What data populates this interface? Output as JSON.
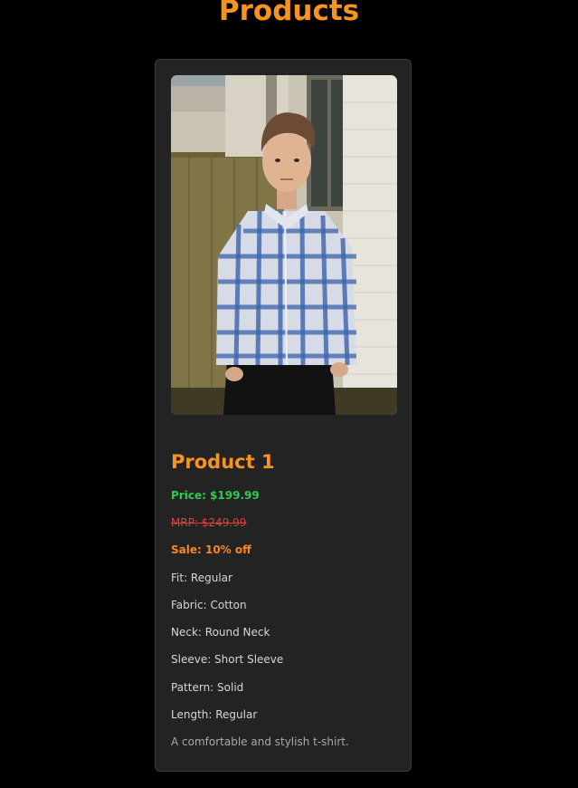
{
  "page": {
    "title": "Products"
  },
  "product": {
    "name": "Product 1",
    "price": "Price: $199.99",
    "mrp": "MRP: $249.99",
    "sale": "Sale: 10% off",
    "fit": "Fit: Regular",
    "fabric": "Fabric: Cotton",
    "neck": "Neck: Round Neck",
    "sleeve": "Sleeve: Short Sleeve",
    "pattern": "Pattern: Solid",
    "length": "Length: Regular",
    "description": "A comfortable and stylish t-shirt."
  },
  "colors": {
    "accent": "#f7931e",
    "price": "#2ecc4f",
    "mrp": "#d9433a",
    "sale": "#f5862a",
    "card_bg": "#232323",
    "page_bg": "#000000"
  }
}
